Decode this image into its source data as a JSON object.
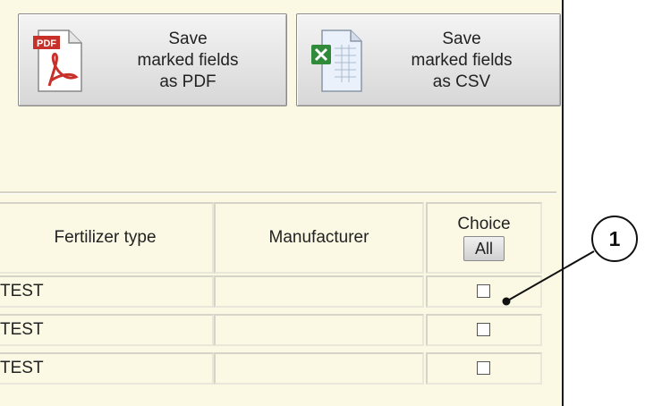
{
  "toolbar": {
    "pdf_button": {
      "lines": [
        "Save",
        "marked fields",
        "as PDF"
      ],
      "icon": "pdf-file-icon",
      "icon_text": "PDF"
    },
    "csv_button": {
      "lines": [
        "Save",
        "marked fields",
        "as CSV"
      ],
      "icon": "excel-file-icon"
    }
  },
  "table": {
    "columns": [
      "Fertilizer type",
      "Manufacturer",
      "Choice"
    ],
    "select_all_label": "All",
    "rows": [
      {
        "fertilizer_type": "TEST",
        "manufacturer": "",
        "selected": false
      },
      {
        "fertilizer_type": "TEST",
        "manufacturer": "",
        "selected": false
      },
      {
        "fertilizer_type": "TEST",
        "manufacturer": "",
        "selected": false
      }
    ]
  },
  "callout": {
    "number": "1"
  },
  "colors": {
    "panel_background": "#fbf9e4",
    "pdf_red": "#c8302a",
    "excel_green": "#2f8a3a"
  }
}
